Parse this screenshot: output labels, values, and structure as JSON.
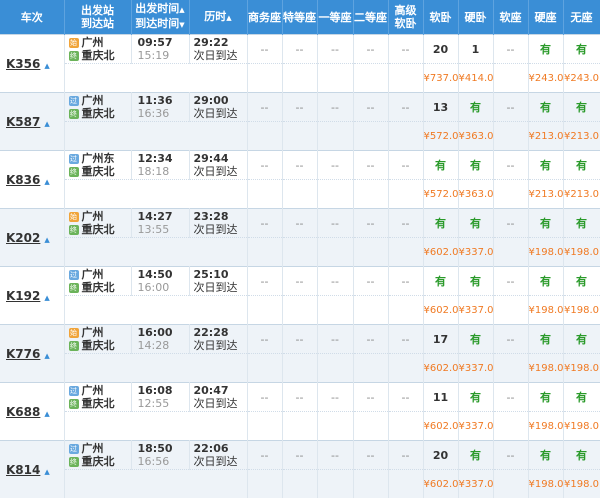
{
  "header": {
    "train_no": "车次",
    "dep_station": "出发站",
    "arr_station": "到达站",
    "dep_time": "出发时间",
    "arr_time": "到达时间",
    "duration": "历时",
    "business": "商务座",
    "special": "特等座",
    "first": "一等座",
    "second": "二等座",
    "deluxe_sleeper_1": "高级",
    "deluxe_sleeper_2": "软卧",
    "soft_sleeper": "软卧",
    "hard_sleeper": "硬卧",
    "soft_seat": "软座",
    "hard_seat": "硬座",
    "no_seat": "无座"
  },
  "badges": {
    "start": "始",
    "pass": "过",
    "end": "终"
  },
  "trains": [
    {
      "code": "K356",
      "dep_type": "start",
      "from": "广州",
      "to": "重庆北",
      "dep": "09:57",
      "arr": "15:19",
      "dur": "29:22",
      "note": "次日到达",
      "avail": [
        "--",
        "--",
        "--",
        "--",
        "--",
        "20",
        "1",
        "--",
        "有",
        "有"
      ],
      "price": [
        "",
        "",
        "",
        "",
        "",
        "¥737.0",
        "¥414.0",
        "",
        "¥243.0",
        "¥243.0"
      ]
    },
    {
      "code": "K587",
      "dep_type": "pass",
      "from": "广州",
      "to": "重庆北",
      "dep": "11:36",
      "arr": "16:36",
      "dur": "29:00",
      "note": "次日到达",
      "avail": [
        "--",
        "--",
        "--",
        "--",
        "--",
        "13",
        "有",
        "--",
        "有",
        "有"
      ],
      "price": [
        "",
        "",
        "",
        "",
        "",
        "¥572.0",
        "¥363.0",
        "",
        "¥213.0",
        "¥213.0"
      ]
    },
    {
      "code": "K836",
      "dep_type": "pass",
      "from": "广州东",
      "to": "重庆北",
      "dep": "12:34",
      "arr": "18:18",
      "dur": "29:44",
      "note": "次日到达",
      "avail": [
        "--",
        "--",
        "--",
        "--",
        "--",
        "有",
        "有",
        "--",
        "有",
        "有"
      ],
      "price": [
        "",
        "",
        "",
        "",
        "",
        "¥572.0",
        "¥363.0",
        "",
        "¥213.0",
        "¥213.0"
      ]
    },
    {
      "code": "K202",
      "dep_type": "start",
      "from": "广州",
      "to": "重庆北",
      "dep": "14:27",
      "arr": "13:55",
      "dur": "23:28",
      "note": "次日到达",
      "avail": [
        "--",
        "--",
        "--",
        "--",
        "--",
        "有",
        "有",
        "--",
        "有",
        "有"
      ],
      "price": [
        "",
        "",
        "",
        "",
        "",
        "¥602.0",
        "¥337.0",
        "",
        "¥198.0",
        "¥198.0"
      ]
    },
    {
      "code": "K192",
      "dep_type": "pass",
      "from": "广州",
      "to": "重庆北",
      "dep": "14:50",
      "arr": "16:00",
      "dur": "25:10",
      "note": "次日到达",
      "avail": [
        "--",
        "--",
        "--",
        "--",
        "--",
        "有",
        "有",
        "--",
        "有",
        "有"
      ],
      "price": [
        "",
        "",
        "",
        "",
        "",
        "¥602.0",
        "¥337.0",
        "",
        "¥198.0",
        "¥198.0"
      ]
    },
    {
      "code": "K776",
      "dep_type": "start",
      "from": "广州",
      "to": "重庆北",
      "dep": "16:00",
      "arr": "14:28",
      "dur": "22:28",
      "note": "次日到达",
      "avail": [
        "--",
        "--",
        "--",
        "--",
        "--",
        "17",
        "有",
        "--",
        "有",
        "有"
      ],
      "price": [
        "",
        "",
        "",
        "",
        "",
        "¥602.0",
        "¥337.0",
        "",
        "¥198.0",
        "¥198.0"
      ]
    },
    {
      "code": "K688",
      "dep_type": "pass",
      "from": "广州",
      "to": "重庆北",
      "dep": "16:08",
      "arr": "12:55",
      "dur": "20:47",
      "note": "次日到达",
      "avail": [
        "--",
        "--",
        "--",
        "--",
        "--",
        "11",
        "有",
        "--",
        "有",
        "有"
      ],
      "price": [
        "",
        "",
        "",
        "",
        "",
        "¥602.0",
        "¥337.0",
        "",
        "¥198.0",
        "¥198.0"
      ]
    },
    {
      "code": "K814",
      "dep_type": "pass",
      "from": "广州",
      "to": "重庆北",
      "dep": "18:50",
      "arr": "16:56",
      "dur": "22:06",
      "note": "次日到达",
      "avail": [
        "--",
        "--",
        "--",
        "--",
        "--",
        "20",
        "有",
        "--",
        "有",
        "有"
      ],
      "price": [
        "",
        "",
        "",
        "",
        "",
        "¥602.0",
        "¥337.0",
        "",
        "¥198.0",
        "¥198.0"
      ]
    }
  ]
}
